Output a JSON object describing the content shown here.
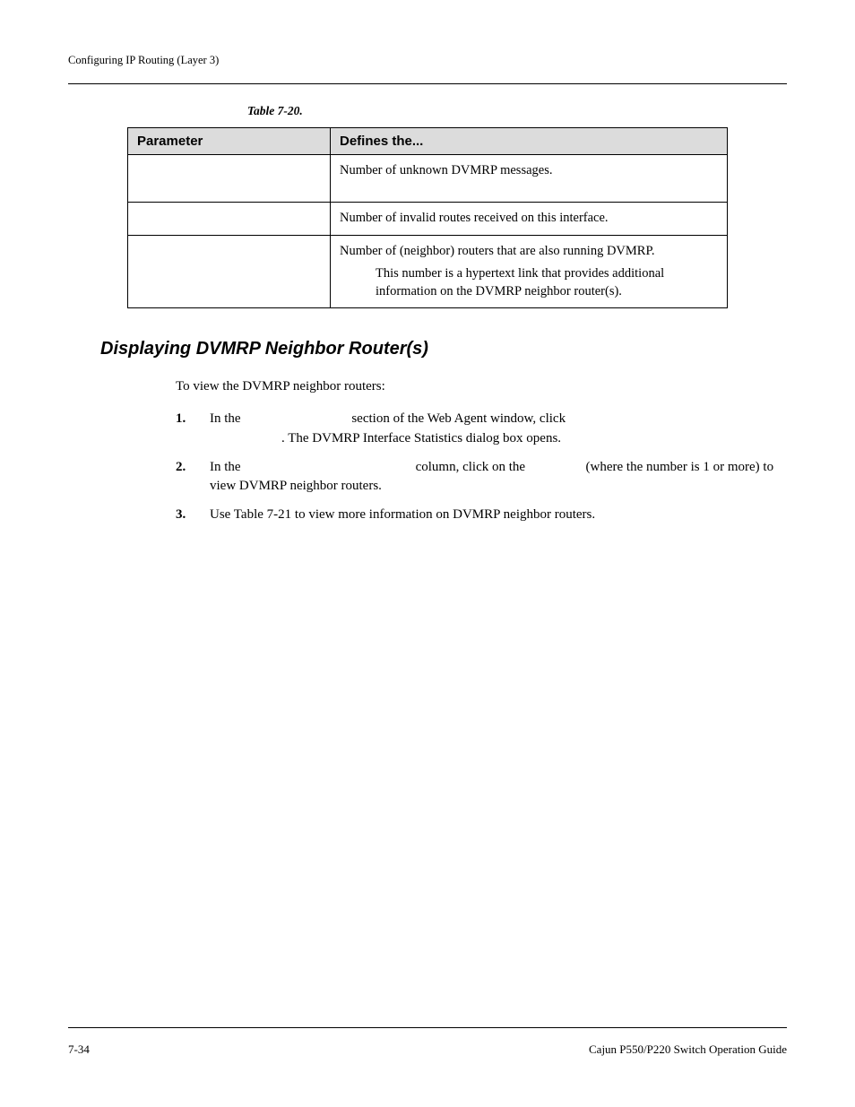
{
  "header": {
    "running": "Configuring IP Routing (Layer 3)"
  },
  "table": {
    "caption_prefix": "Table 7-20.",
    "columns": {
      "param": "Parameter",
      "def": "Defines the..."
    },
    "rows": [
      {
        "param": "",
        "def": "Number of unknown DVMRP messages."
      },
      {
        "param": "",
        "def": "Number of invalid routes received on this interface."
      },
      {
        "param": "",
        "def_line1": "Number of (neighbor) routers that are also running DVMRP.",
        "def_note": "This number is a hypertext link that provides additional information on the DVMRP neighbor router(s)."
      }
    ]
  },
  "section": {
    "title": "Displaying DVMRP Neighbor Router(s)",
    "lead": "To view the DVMRP neighbor routers:",
    "steps": {
      "s1_a": "In the",
      "s1_b": "section of the Web Agent window, click",
      "s1_c": ". The DVMRP Interface Statistics dialog box opens.",
      "s2_a": "In the",
      "s2_b": "column, click on the",
      "s2_c": "(where the number is 1 or more) to view DVMRP neighbor routers.",
      "s3": "Use Table 7-21 to view more information on DVMRP neighbor routers."
    }
  },
  "footer": {
    "page": "7-34",
    "guide": "Cajun P550/P220 Switch Operation Guide"
  }
}
